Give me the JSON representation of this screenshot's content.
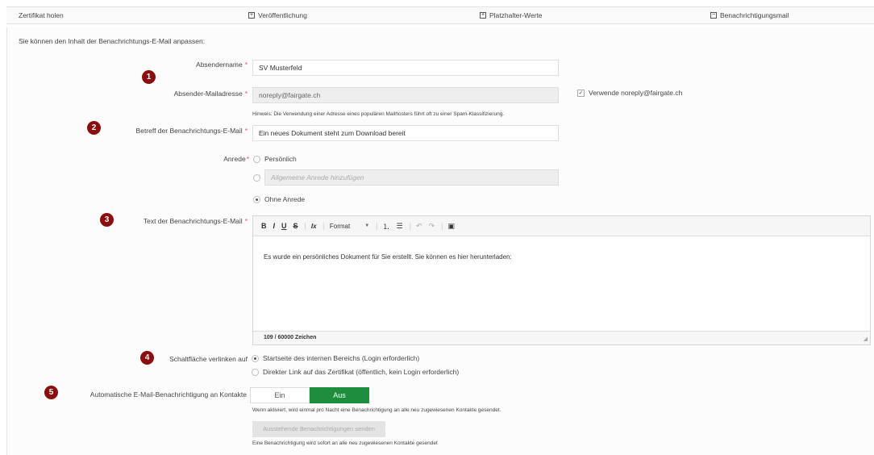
{
  "tabs": [
    {
      "label": "Zertifikat holen",
      "icon": ""
    },
    {
      "label": "Veröffentlichung",
      "icon": "plus-box-icon"
    },
    {
      "label": "Platzhalter-Werte",
      "icon": "plus-box-icon"
    },
    {
      "label": "Benachrichtigungsmail",
      "icon": "minus-box-icon"
    }
  ],
  "intro": "Sie können den Inhalt der Benachrichtungs-E-Mail anpassen:",
  "required_mark": "*",
  "sender_name": {
    "label": "Absendername",
    "value": "SV Musterfeld"
  },
  "sender_mail": {
    "label": "Absender-Mailadresse",
    "value": "noreply@fairgate.ch",
    "checkbox_label": "Verwende noreply@fairgate.ch",
    "checked": true,
    "hint": "Hinweis: Die Verwendung einer Adresse eines populären Mailhosters führt oft zu einer Spam-Klassifizierung."
  },
  "subject": {
    "label": "Betreff der Benachrichtungs-E-Mail",
    "value": "Ein neues Dokument steht zum Download bereit"
  },
  "salutation": {
    "label": "Anrede",
    "option_personal": "Persönlich",
    "option_general_placeholder": "Allgemeine Anrede hinzufügen",
    "option_none": "Ohne Anrede",
    "selected": "Ohne Anrede"
  },
  "body_text": {
    "label": "Text der Benachrichtungs-E-Mail",
    "toolbar": {
      "bold": "B",
      "italic": "I",
      "underline": "U",
      "strike": "S",
      "clear": "Ix",
      "format": "Format"
    },
    "content": "Es wurde ein persönliches Dokument für Sie erstellt. Sie können es hier herunterladen:",
    "counter": "109 / 60000 Zeichen"
  },
  "link_button": {
    "label": "Schaltfläche verlinken auf",
    "option_internal": "Startseite des internen Bereichs (Login erforderlich)",
    "option_direct": "Direkter Link auf das Zertifikat (öffentlich, kein Login erforderlich)",
    "selected": "Startseite des internen Bereichs (Login erforderlich)"
  },
  "auto_notify": {
    "label": "Automatische E-Mail-Benachrichtigung an Kontakte",
    "off_label": "Ein",
    "on_label": "Aus",
    "active": "Aus",
    "hint": "Wenn aktiviert, wird einmal pro Nacht eine Benachrichtigung an alle neu zugewiesenen Kontakte gesendet.",
    "send_button": "Ausstehende Benachrichtigungen senden",
    "send_hint": "Eine Benachrichtigung wird sofort an alle neu zugewiesenen Kontakte gesendet"
  },
  "badges": [
    "1",
    "2",
    "3",
    "4",
    "5"
  ],
  "colors": {
    "badge": "#8b0e0e",
    "toggle_active": "#1e8e3e",
    "required": "#d9534f"
  }
}
